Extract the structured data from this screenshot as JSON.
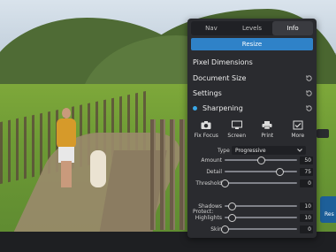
{
  "tabs": [
    {
      "label": "Nav",
      "active": false
    },
    {
      "label": "Levels",
      "active": false
    },
    {
      "label": "Info",
      "active": true
    }
  ],
  "resize_button": "Resize",
  "sections": {
    "pixel_dimensions": "Pixel Dimensions",
    "document_size": "Document Size",
    "settings": "Settings",
    "sharpening": "Sharpening"
  },
  "tools": [
    {
      "label": "Fix Focus",
      "icon": "camera-icon"
    },
    {
      "label": "Screen",
      "icon": "monitor-icon"
    },
    {
      "label": "Print",
      "icon": "printer-icon"
    },
    {
      "label": "More",
      "icon": "more-checkbox-icon"
    }
  ],
  "type": {
    "label": "Type",
    "value": "Progressive"
  },
  "sliders": [
    {
      "label": "Amount",
      "value": "50",
      "level": 0.5
    },
    {
      "label": "Detail",
      "value": "75",
      "level": 0.75
    },
    {
      "label": "Threshold",
      "value": "0",
      "level": 0.0
    }
  ],
  "protect_label": "Protect:",
  "protect_sliders": [
    {
      "label": "Shadows",
      "value": "10",
      "level": 0.1
    },
    {
      "label": "Highlights",
      "value": "10",
      "level": 0.1
    },
    {
      "label": "Skin",
      "value": "0",
      "level": 0.0
    }
  ],
  "edge_button_label": "Res",
  "colors": {
    "accent": "#2f82c8",
    "panel": "#2a2b2f",
    "dot": "#3aa7e6"
  }
}
